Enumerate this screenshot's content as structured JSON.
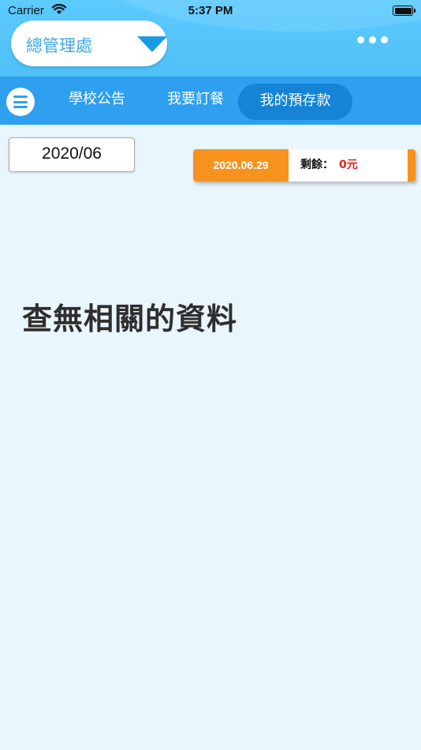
{
  "status_bar": {
    "carrier": "Carrier",
    "time": "5:37 PM",
    "battery_level": 1.0
  },
  "header": {
    "org_selector": "總管理處",
    "more_icon": "more-dots-icon"
  },
  "nav": {
    "menu_icon": "hamburger-menu-icon",
    "tabs": [
      {
        "label": "學校公告",
        "active": false
      },
      {
        "label": "我要訂餐",
        "active": false
      },
      {
        "label": "我的預存款",
        "active": true
      }
    ]
  },
  "filter": {
    "month": "2020/06"
  },
  "balance": {
    "date": "2020.06.29",
    "label": "剩餘：",
    "value": "0元"
  },
  "content": {
    "empty_message": "查無相關的資料"
  },
  "colors": {
    "header_bg": "#5ccaff",
    "nav_bg": "#2f9ff0",
    "active_tab": "#1583d6",
    "accent_orange": "#f7921e",
    "value_red": "#e0201a",
    "page_bg": "#eaf6fd"
  }
}
